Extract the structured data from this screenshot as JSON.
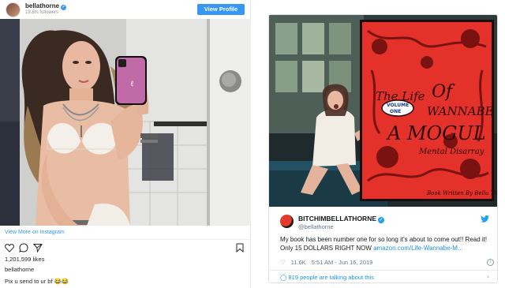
{
  "instagram": {
    "username": "bellathorne",
    "followers": "19.8m followers",
    "view_profile_label": "View Profile",
    "view_more": "View More on Instagram",
    "likes": "1,201,599 likes",
    "owner": "bellathorne",
    "caption": "Pix u send to ur bf 😂😂",
    "accent_color": "#3897f0"
  },
  "twitter": {
    "display_name": "BITCHIMBELLATHORNE",
    "handle": "@bellathorne",
    "tweet_text": "My book has been number one for so long it's about to come out!! Read it! Only 15 DOLLARS RIGHT NOW ",
    "tweet_link": "amazon.com/Life-Wannabe-M...",
    "likes": "11.6K",
    "timestamp": "5:51 AM - Jun 16, 2019",
    "talking": "819 people are talking about this",
    "accent_color": "#1da1f2"
  }
}
